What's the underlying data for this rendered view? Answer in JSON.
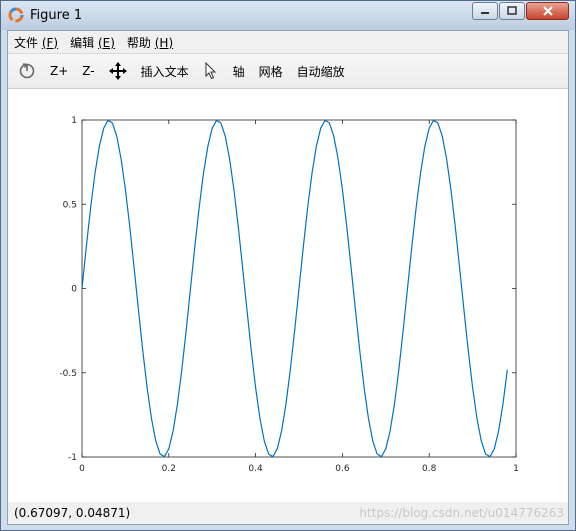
{
  "window": {
    "title": "Figure 1",
    "controls": [
      "minimize",
      "maximize",
      "close"
    ]
  },
  "menubar": {
    "items": [
      {
        "label": "文件",
        "accel": "(F)"
      },
      {
        "label": "编辑",
        "accel": "(E)"
      },
      {
        "label": "帮助",
        "accel": "(H)"
      }
    ]
  },
  "toolbar": {
    "rotate_icon": "rotate-icon",
    "zoom_in_label": "Z+",
    "zoom_out_label": "Z-",
    "pan_icon": "pan-icon",
    "insert_text_label": "插入文本",
    "select_icon": "cursor-arrow-icon",
    "axis_label": "轴",
    "grid_label": "网格",
    "autoscale_label": "自动缩放"
  },
  "status": {
    "coords": "(0.67097, 0.04871)",
    "watermark": "https://blog.csdn.net/u014776263"
  },
  "chart_data": {
    "type": "line",
    "function": "sin(2*pi*4*x)",
    "x_range": [
      0,
      0.98
    ],
    "samples": 99,
    "xlim": [
      0,
      1
    ],
    "ylim": [
      -1,
      1
    ],
    "xticks": [
      "0",
      "0.2",
      "0.4",
      "0.6",
      "0.8",
      "1"
    ],
    "yticks": [
      "1",
      "0.5",
      "0",
      "-0.5",
      "-1"
    ],
    "line_color": "#0072bd",
    "grid": false
  }
}
